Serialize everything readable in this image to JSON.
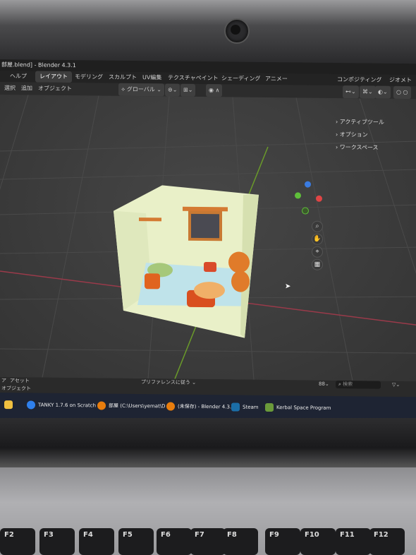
{
  "window": {
    "title": "部屋.blend] - Blender 4.3.1"
  },
  "menu": [
    "ヘルプ",
    "レイアウト",
    "モデリング",
    "スカルプト",
    "UV編集",
    "テクスチャペイント",
    "シェーディング",
    "アニメー",
    "コンポジティング",
    "ジオメトリ"
  ],
  "header": {
    "select": "選択",
    "add": "追加",
    "object": "オブジェクト",
    "transform": "グローバル"
  },
  "sidebar": {
    "items": [
      "アクティブツール",
      "オプション",
      "ワークスペース"
    ]
  },
  "status": {
    "left_top": "ア",
    "asset": "アセット",
    "left_bottom": "オブジェクト",
    "preference": "プリファレンスに従う",
    "search": "検索"
  },
  "taskbar": [
    {
      "label": "TANKY 1.7.6 on Scratch",
      "color": "#2f80ed"
    },
    {
      "label": "部屋 (C:\\Users\\yemat\\D",
      "color": "#e87d0d"
    },
    {
      "label": "(未保存) - Blender 4.3.1",
      "color": "#e87d0d"
    },
    {
      "label": "Steam",
      "color": "#1b6ea8"
    },
    {
      "label": "Kerbal Space Program",
      "color": "#6a9a3a"
    }
  ],
  "keys": [
    "F2",
    "F3",
    "F4",
    "F5",
    "F6",
    "F7",
    "F8",
    "F9",
    "F10",
    "F11",
    "F12"
  ],
  "colors": {
    "accent": "#4772b3",
    "room_wall": "#e9f0c8",
    "room_floor": "#bfe3ea",
    "furniture": "#e0641f"
  }
}
